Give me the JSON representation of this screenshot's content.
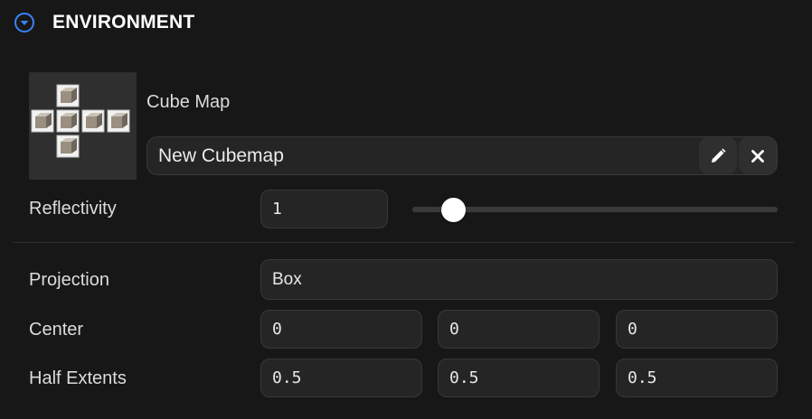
{
  "header": {
    "title": "ENVIRONMENT",
    "collapse_icon": "chevron-down-circle-icon",
    "accent_color": "#3b82f6"
  },
  "cubemap": {
    "label": "Cube Map",
    "asset_name": "New Cubemap",
    "thumbnail_icon": "cubemap-cross-icon",
    "edit_icon": "pencil-icon",
    "clear_icon": "close-icon"
  },
  "reflectivity": {
    "label": "Reflectivity",
    "value": "1",
    "slider_fraction": 0.085
  },
  "projection": {
    "label": "Projection",
    "value": "Box"
  },
  "center": {
    "label": "Center",
    "x": "0",
    "y": "0",
    "z": "0"
  },
  "half_extents": {
    "label": "Half Extents",
    "x": "0.5",
    "y": "0.5",
    "z": "0.5"
  }
}
